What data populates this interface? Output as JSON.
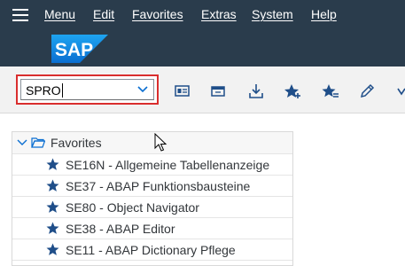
{
  "menubar": {
    "items": [
      {
        "label": "Menu"
      },
      {
        "label": "Edit"
      },
      {
        "label": "Favorites"
      },
      {
        "label": "Extras"
      },
      {
        "label": "System"
      },
      {
        "label": "Help"
      }
    ]
  },
  "logo": {
    "text": "SAP"
  },
  "toolbar": {
    "command_field_value": "SPRO",
    "icons": [
      "display-object-icon",
      "display-in-window-icon",
      "download-icon",
      "add-favorite-icon",
      "edit-favorites-icon",
      "pencil-icon",
      "more-chevron-icon"
    ]
  },
  "favorites": {
    "header": "Favorites",
    "items": [
      {
        "label": "SE16N - Allgemeine Tabellenanzeige"
      },
      {
        "label": "SE37 - ABAP Funktionsbausteine"
      },
      {
        "label": "SE80 - Object Navigator"
      },
      {
        "label": "SE38 - ABAP Editor"
      },
      {
        "label": "SE11 - ABAP Dictionary Pflege"
      }
    ]
  },
  "colors": {
    "header_bg": "#2a3c4c",
    "sap_blue": "#0a6ed1",
    "highlight_red": "#d92e2e",
    "icon_blue": "#1f4e89"
  }
}
